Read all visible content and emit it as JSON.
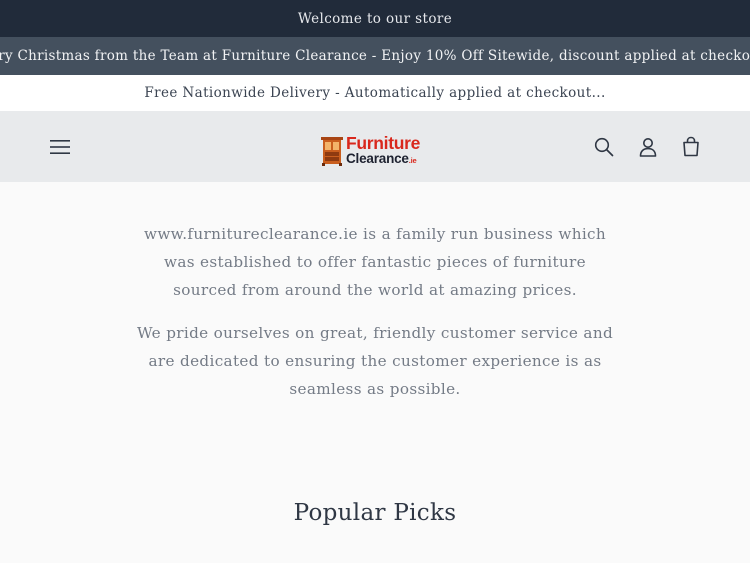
{
  "announcements": {
    "welcome": "Welcome to our store",
    "christmas": "Merry Christmas from the Team at Furniture Clearance - Enjoy 10% Off Sitewide, discount applied at checkout !!",
    "delivery": "Free Nationwide Delivery - Automatically applied at checkout..."
  },
  "header": {
    "logo": {
      "line1": "Furniture",
      "line2": "Clearance",
      "suffix": ".ie"
    },
    "icons": {
      "menu": "hamburger-icon",
      "search": "search-icon",
      "account": "user-icon",
      "cart": "cart-icon"
    }
  },
  "about": {
    "paragraph1": "www.furnitureclearance.ie is a family run business which was established to offer fantastic pieces of furniture sourced from around the world at amazing prices.",
    "paragraph2": "We pride ourselves on great, friendly customer service and are dedicated to ensuring the customer experience is as seamless as possible."
  },
  "popular": {
    "title": "Popular Picks"
  },
  "colors": {
    "welcome_bar": "#212b3a",
    "christmas_bar": "#44505e",
    "header_bg": "#e8eaec",
    "logo_red": "#d9281d",
    "logo_dark": "#1e2230",
    "body_text": "#747b86"
  }
}
